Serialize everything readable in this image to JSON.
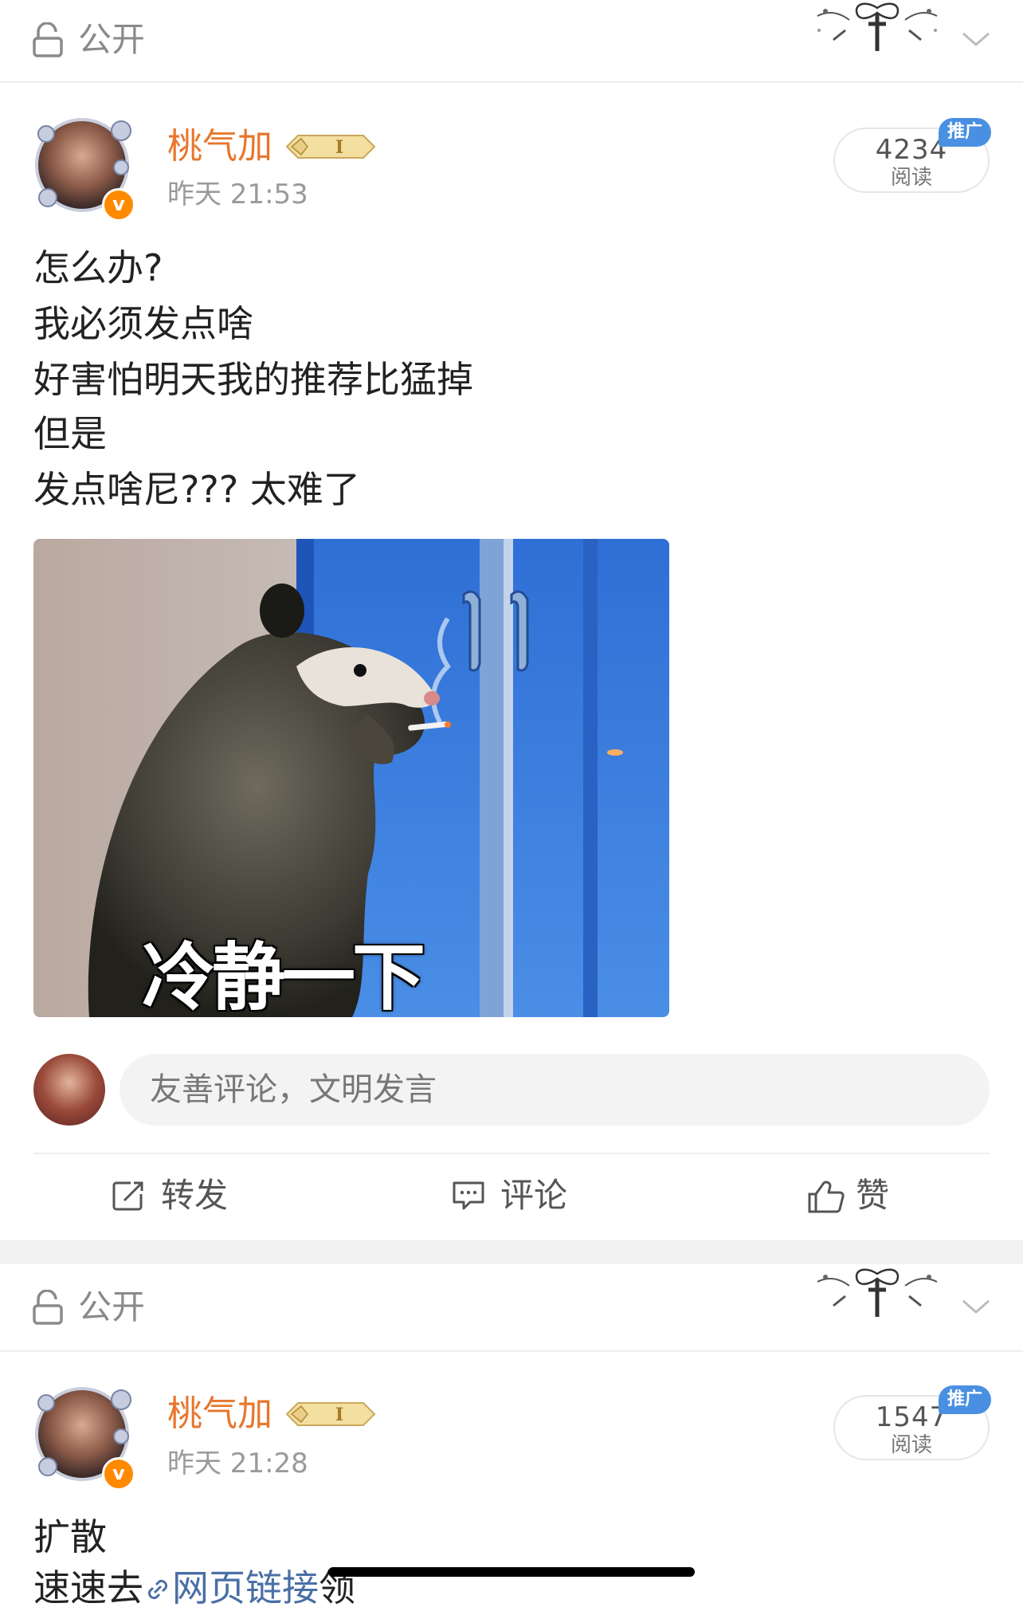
{
  "posts": [
    {
      "privacy_label": "公开",
      "username": "桃气加",
      "vip_level": "I",
      "time": "昨天 21:53",
      "reads_count": "4234",
      "reads_label": "阅读",
      "promo_label": "推广",
      "content_lines": [
        "怎么办?",
        "我必须发点啥",
        "好害怕明天我的推荐比猛掉",
        "但是",
        "发点啥尼??? 太难了"
      ],
      "image_caption": "冷静一下",
      "comment_placeholder": "友善评论，文明发言",
      "actions": {
        "repost": "转发",
        "comment": "评论",
        "like": "赞"
      }
    },
    {
      "privacy_label": "公开",
      "username": "桃气加",
      "vip_level": "I",
      "time": "昨天 21:28",
      "reads_count": "1547",
      "reads_label": "阅读",
      "promo_label": "推广",
      "content_line_1": "扩散",
      "content_line_2_prefix": "速速去",
      "content_line_2_link": "网页链接",
      "content_line_2_suffix": "领"
    }
  ],
  "colors": {
    "username": "#e8762c",
    "promo": "#4a90e2",
    "link": "#4a6fa5",
    "vbadge": "#ff8a00"
  }
}
